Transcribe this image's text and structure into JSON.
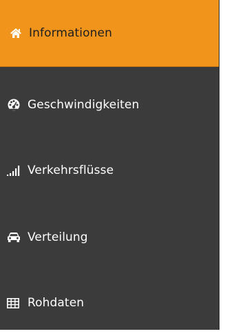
{
  "sidebar": {
    "items": [
      {
        "label": "Informationen",
        "icon": "home-icon",
        "active": true
      },
      {
        "label": "Geschwindigkeiten",
        "icon": "speedometer-icon",
        "active": false
      },
      {
        "label": "Verkehrsflüsse",
        "icon": "signal-bars-icon",
        "active": false
      },
      {
        "label": "Verteilung",
        "icon": "car-icon",
        "active": false
      },
      {
        "label": "Rohdaten",
        "icon": "table-icon",
        "active": false
      }
    ]
  },
  "colors": {
    "sidebar_background": "#3b3b3b",
    "active_background": "#f0941c",
    "text": "#ffffff",
    "active_icon": "#ffffff"
  }
}
